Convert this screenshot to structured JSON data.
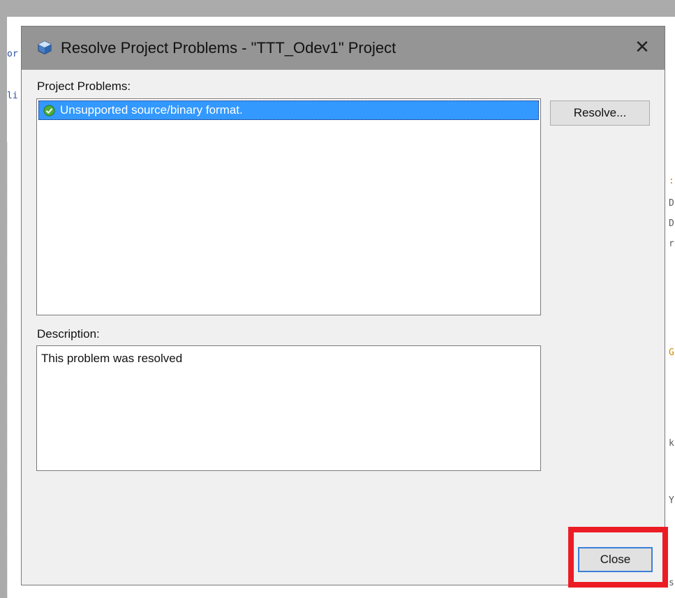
{
  "background": {
    "fragments": [
      "or",
      "li",
      ":\"",
      "D",
      "D",
      "r",
      "G",
      "k",
      "Y",
      "s"
    ]
  },
  "dialog": {
    "title": "Resolve Project Problems - \"TTT_Odev1\" Project",
    "close_glyph": "✕",
    "problems_label": "Project Problems:",
    "problems": [
      {
        "text": "Unsupported source/binary format.",
        "status": "resolved",
        "selected": true
      }
    ],
    "resolve_button": "Resolve...",
    "description_label": "Description:",
    "description": "This problem was resolved",
    "close_button": "Close"
  },
  "colors": {
    "selection": "#3399ff",
    "titlebar": "#959595",
    "highlight": "#ec1c24",
    "resolved_check": "#4caf3c"
  }
}
